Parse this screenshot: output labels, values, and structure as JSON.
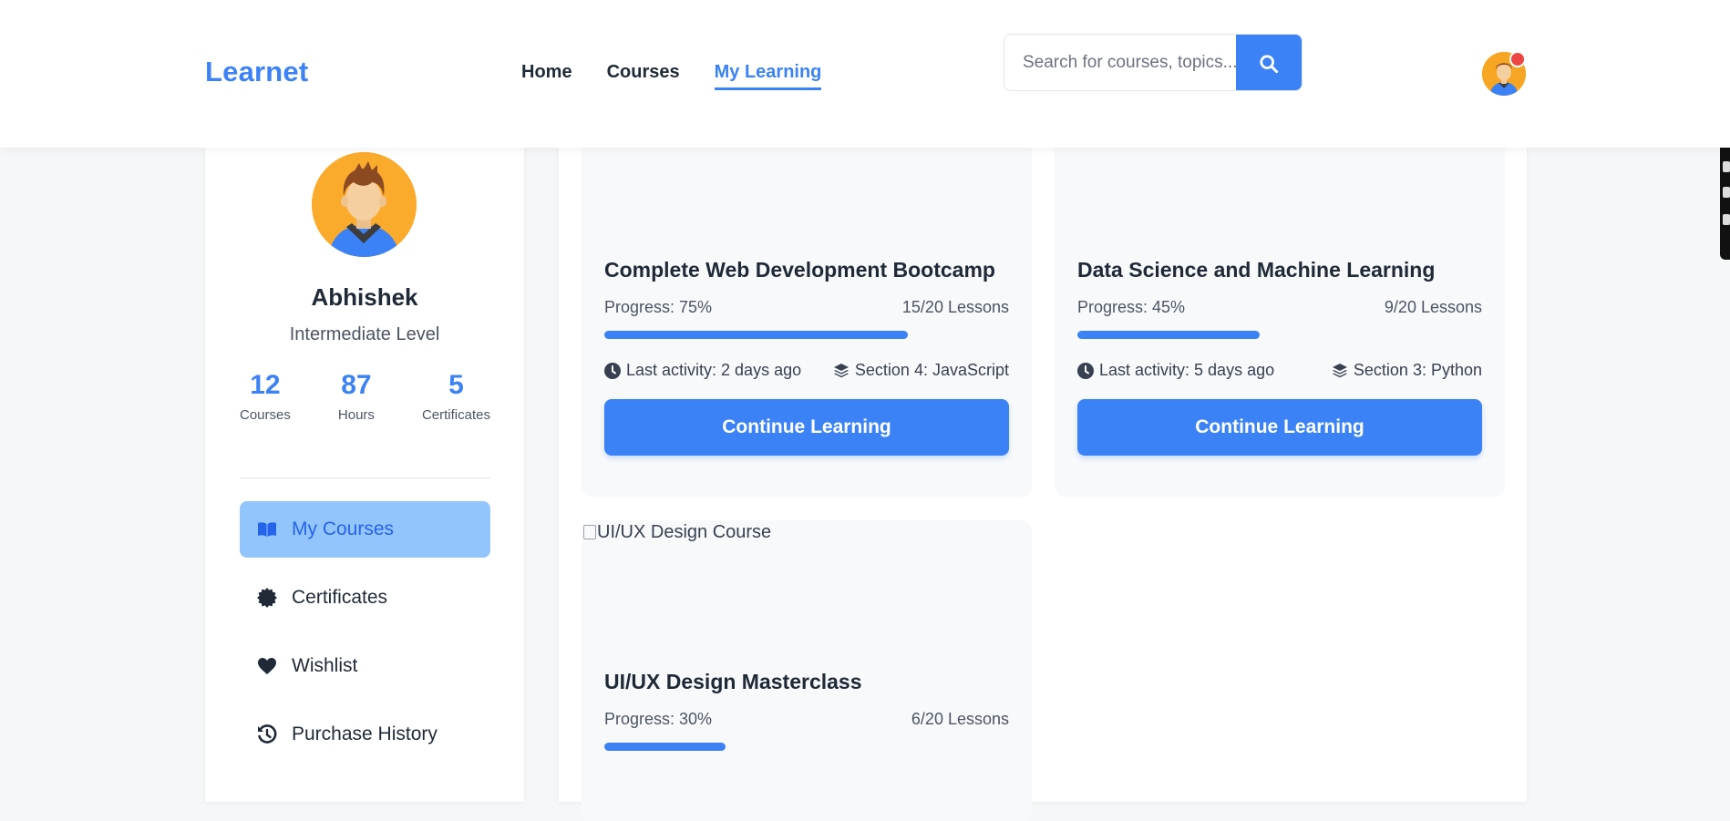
{
  "header": {
    "logo": "Learnet",
    "nav": [
      {
        "label": "Home",
        "active": false
      },
      {
        "label": "Courses",
        "active": false
      },
      {
        "label": "My Learning",
        "active": true
      }
    ],
    "search_placeholder": "Search for courses, topics..."
  },
  "profile": {
    "name": "Abhishek",
    "level": "Intermediate Level",
    "stats": [
      {
        "value": "12",
        "label": "Courses"
      },
      {
        "value": "87",
        "label": "Hours"
      },
      {
        "value": "5",
        "label": "Certificates"
      }
    ],
    "menu": [
      {
        "label": "My Courses",
        "icon": "open-book-icon",
        "active": true
      },
      {
        "label": "Certificates",
        "icon": "certificate-badge-icon",
        "active": false
      },
      {
        "label": "Wishlist",
        "icon": "heart-icon",
        "active": false
      },
      {
        "label": "Purchase History",
        "icon": "history-icon",
        "active": false
      }
    ]
  },
  "courses": [
    {
      "title": "Complete Web Development Bootcamp",
      "progress_label": "Progress: 75%",
      "progress": 0.75,
      "lessons": "15/20 Lessons",
      "last_activity": "Last activity: 2 days ago",
      "section": "Section 4: JavaScript",
      "button": "Continue Learning"
    },
    {
      "title": "Data Science and Machine Learning",
      "progress_label": "Progress: 45%",
      "progress": 0.45,
      "lessons": "9/20 Lessons",
      "last_activity": "Last activity: 5 days ago",
      "section": "Section 3: Python",
      "button": "Continue Learning"
    },
    {
      "image_alt": "UI/UX Design Course",
      "title": "UI/UX Design Masterclass",
      "progress_label": "Progress: 30%",
      "progress": 0.3,
      "lessons": "6/20 Lessons"
    }
  ],
  "colors": {
    "accent": "#3b82f6",
    "active_menu_bg": "#93c5fd"
  }
}
